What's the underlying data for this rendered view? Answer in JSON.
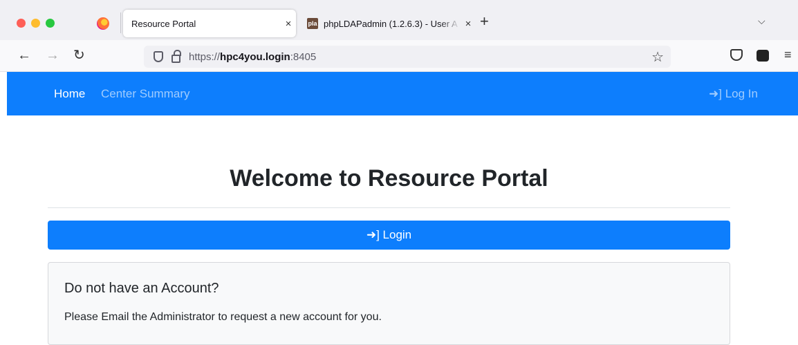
{
  "browser": {
    "tabs": [
      {
        "title": "Resource Portal",
        "close": "×",
        "active": true
      },
      {
        "title": "phpLDAPadmin (1.2.6.3) - User A",
        "close": "×",
        "active": false
      }
    ],
    "new_tab": "+",
    "tab_list": "⌵",
    "nav": {
      "back": "←",
      "forward": "→",
      "reload": "↻"
    },
    "url": {
      "prefix": "https://",
      "host": "hpc4you.login",
      "port": ":8405"
    },
    "bookmark_star": "☆",
    "menu": "≡"
  },
  "site": {
    "navbar": {
      "home": "Home",
      "center_summary": "Center Summary",
      "log_in": "➜] Log In",
      "background": "#0d7efd"
    },
    "heading": "Welcome to Resource Portal",
    "login_button": "➜] Login",
    "card": {
      "title": "Do not have an Account?",
      "text": "Please Email the Administrator to request a new account for you."
    }
  },
  "icons": [
    "firefox-logo-icon",
    "shield-icon",
    "lock-icon",
    "star-icon",
    "pocket-icon",
    "extension-icon",
    "hamburger-menu-icon",
    "sign-in-icon"
  ]
}
